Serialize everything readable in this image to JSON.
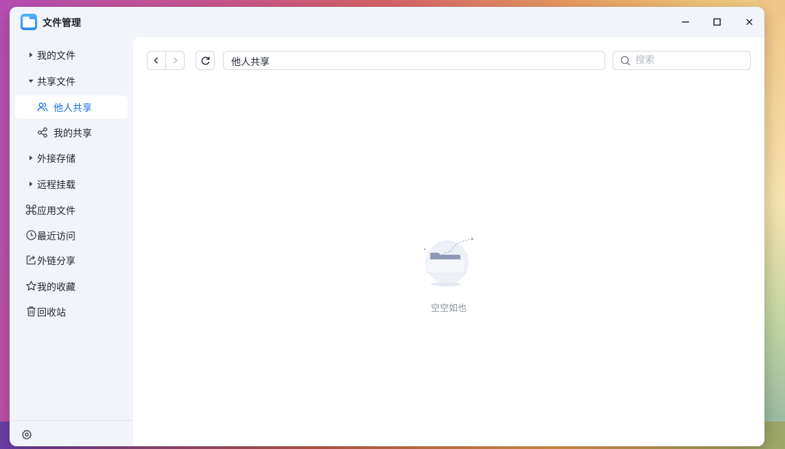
{
  "window": {
    "title": "文件管理",
    "controls": [
      "minimize-icon",
      "maximize-icon",
      "close-icon"
    ]
  },
  "sidebar": {
    "items": [
      {
        "label": "我的文件",
        "icon": "caret-right-icon"
      },
      {
        "label": "共享文件",
        "icon": "caret-down-icon"
      },
      {
        "label": "他人共享",
        "icon": "users-icon",
        "active": true
      },
      {
        "label": "我的共享",
        "icon": "share-icon"
      },
      {
        "label": "外接存储",
        "icon": "caret-right-icon"
      },
      {
        "label": "远程挂载",
        "icon": "caret-right-icon"
      },
      {
        "label": "应用文件",
        "icon": "command-icon"
      },
      {
        "label": "最近访问",
        "icon": "clock-icon"
      },
      {
        "label": "外链分享",
        "icon": "export-icon"
      },
      {
        "label": "我的收藏",
        "icon": "star-icon"
      },
      {
        "label": "回收站",
        "icon": "trash-icon"
      }
    ],
    "footer_icon": "settings-icon"
  },
  "toolbar": {
    "path": "他人共享",
    "search_placeholder": "搜索"
  },
  "main": {
    "empty_text": "空空如也"
  },
  "colors": {
    "accent": "#1a6ee8",
    "sidebar_bg": "#f1f4f9",
    "content_bg": "#ffffff"
  }
}
